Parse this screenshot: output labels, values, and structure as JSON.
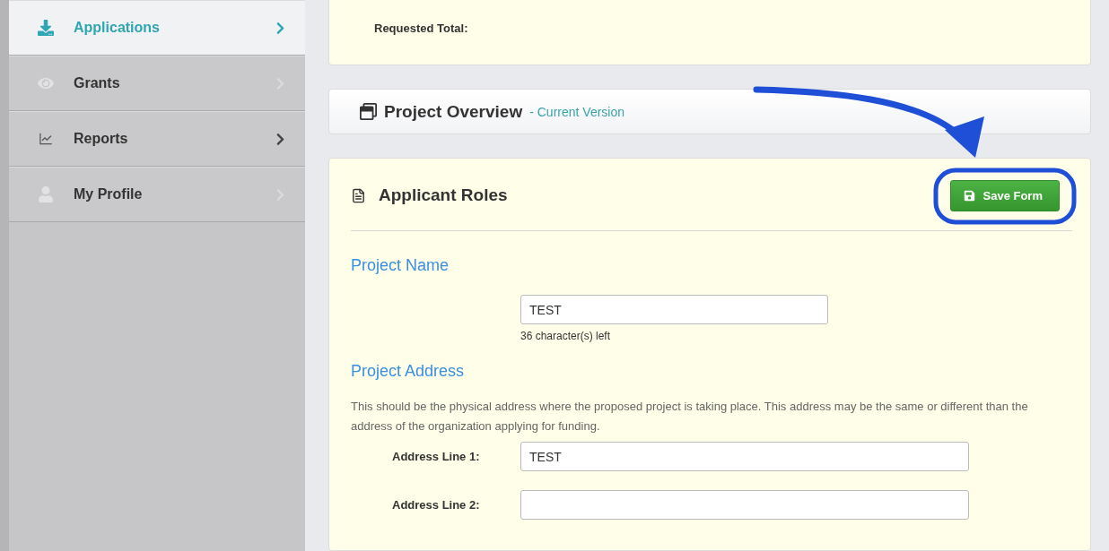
{
  "sidebar": {
    "items": [
      {
        "label": "Applications",
        "selected": true,
        "disabled": false
      },
      {
        "label": "Grants",
        "selected": false,
        "disabled": true
      },
      {
        "label": "Reports",
        "selected": false,
        "disabled": false
      },
      {
        "label": "My Profile",
        "selected": false,
        "disabled": true
      }
    ]
  },
  "summary": {
    "label": "Requested Total:"
  },
  "overview": {
    "title": "Project Overview",
    "version": "- Current Version"
  },
  "form": {
    "title": "Applicant Roles",
    "save_button": "Save Form",
    "project_name": {
      "heading": "Project Name",
      "value": "TEST",
      "hint": "36 character(s) left"
    },
    "project_address": {
      "heading": "Project Address",
      "description": "This should be the physical address where the proposed project is taking place. This address may be the same or different than the address of the organization applying for funding.",
      "fields": [
        {
          "label": "Address Line 1:",
          "value": "TEST"
        },
        {
          "label": "Address Line 2:"
        }
      ]
    }
  }
}
